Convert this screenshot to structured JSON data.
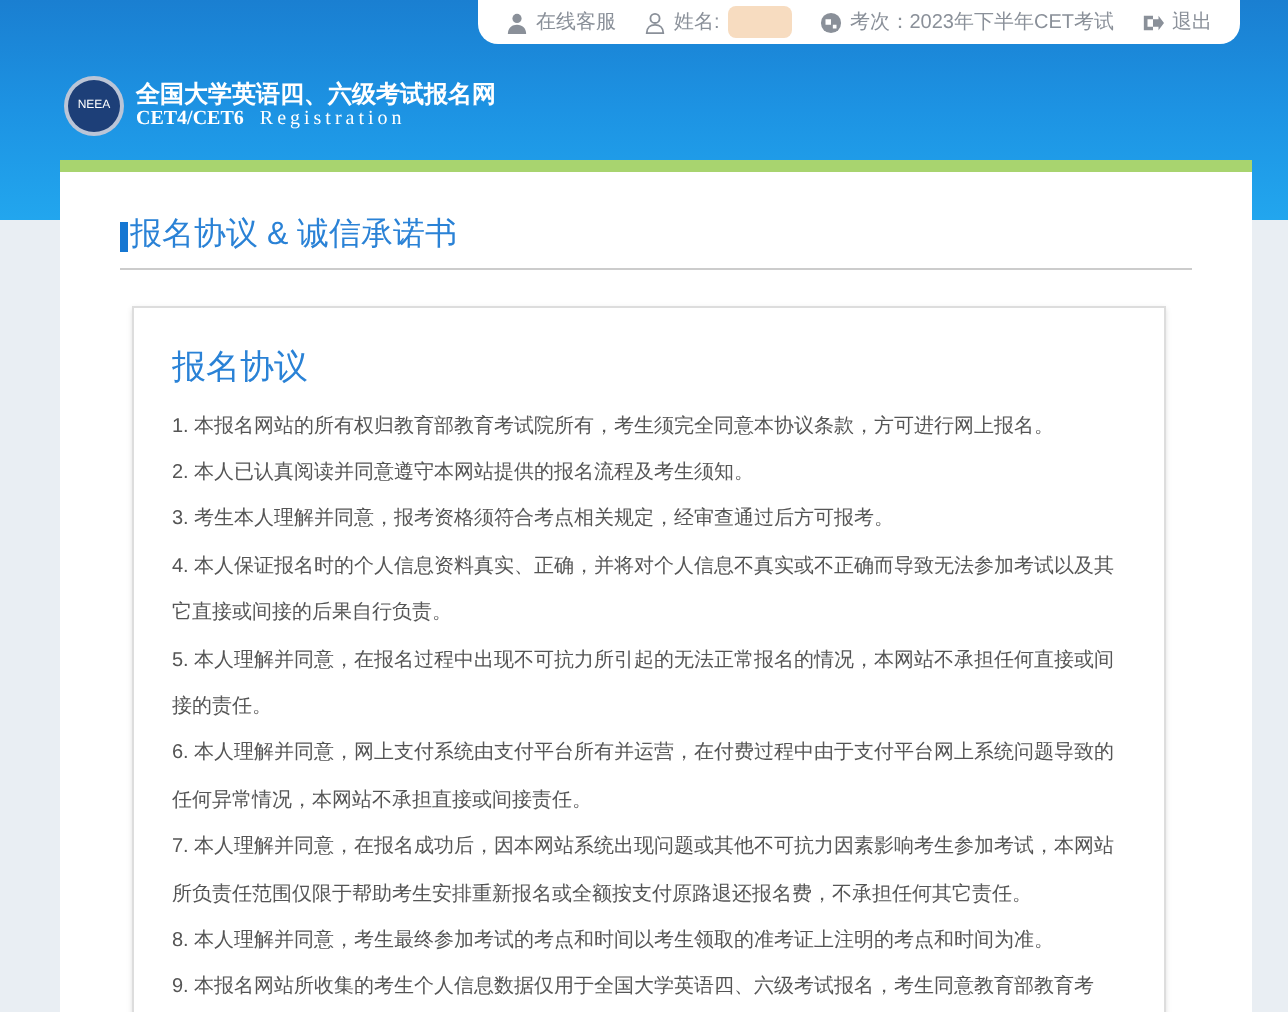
{
  "top_bar": {
    "items": [
      {
        "kind": "service",
        "label": "在线客服"
      },
      {
        "kind": "name",
        "label": "姓名:"
      },
      {
        "kind": "exam",
        "label": "考次：2023年下半年CET考试"
      },
      {
        "kind": "logout",
        "label": "退出"
      }
    ]
  },
  "site": {
    "title": "全国大学英语四、六级考试报名网",
    "subtitle_left": "CET4/CET6",
    "subtitle_right": "Registration",
    "logo_text": "NEEA"
  },
  "page_title": "报名协议 & 诚信承诺书",
  "agreement": {
    "heading": "报名协议",
    "clauses": [
      "1. 本报名网站的所有权归教育部教育考试院所有，考生须完全同意本协议条款，方可进行网上报名。",
      "2. 本人已认真阅读并同意遵守本网站提供的报名流程及考生须知。",
      "3. 考生本人理解并同意，报考资格须符合考点相关规定，经审查通过后方可报考。",
      "4. 本人保证报名时的个人信息资料真实、正确，并将对个人信息不真实或不正确而导致无法参加考试以及其它直接或间接的后果自行负责。",
      "5. 本人理解并同意，在报名过程中出现不可抗力所引起的无法正常报名的情况，本网站不承担任何直接或间接的责任。",
      "6. 本人理解并同意，网上支付系统由支付平台所有并运营，在付费过程中由于支付平台网上系统问题导致的任何异常情况，本网站不承担直接或间接责任。",
      "7. 本人理解并同意，在报名成功后，因本网站系统出现问题或其他不可抗力因素影响考生参加考试，本网站所负责任范围仅限于帮助考生安排重新报名或全额按支付原路退还报名费，不承担任何其它责任。",
      "8. 本人理解并同意，考生最终参加考试的考点和时间以考生领取的准考证上注明的考点和时间为准。",
      "9. 本报名网站所收集的考生个人信息数据仅用于全国大学英语四、六级考试报名，考生同意教育部教育考"
    ]
  }
}
